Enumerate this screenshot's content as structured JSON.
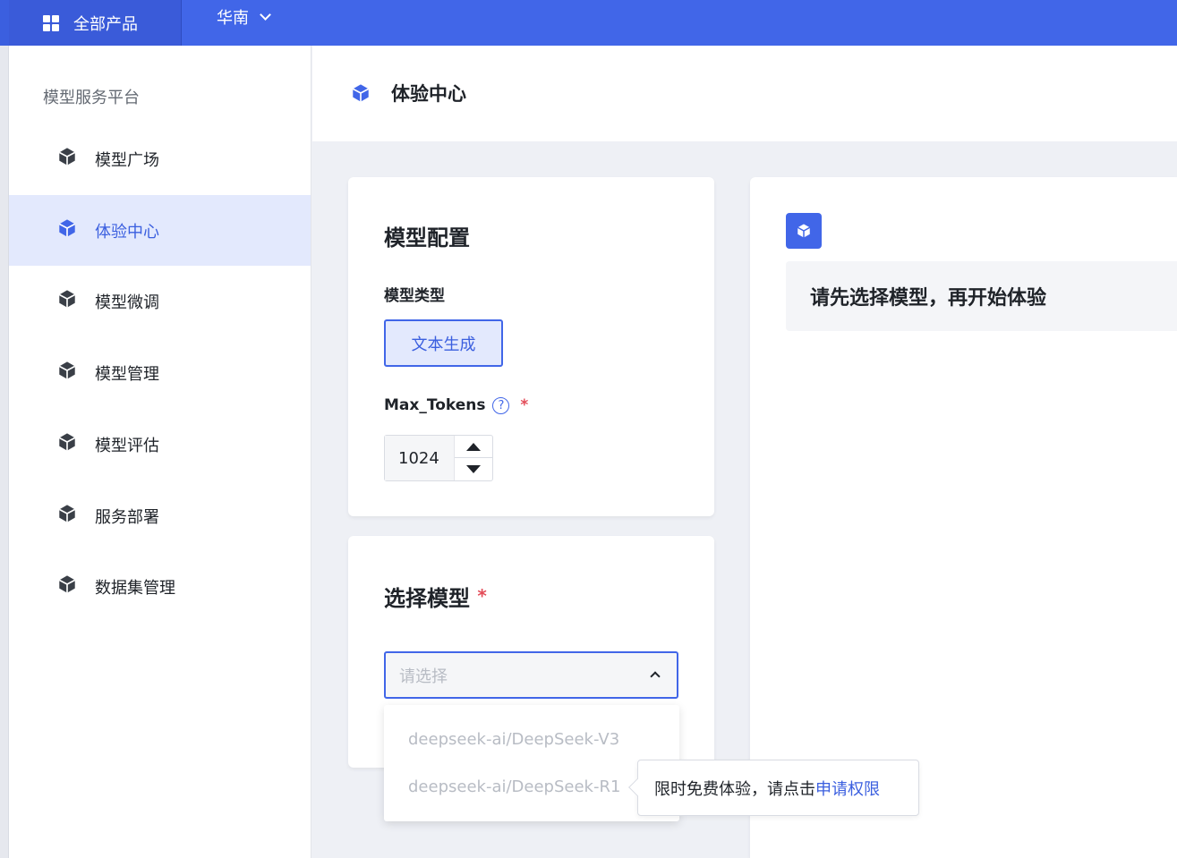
{
  "topbar": {
    "products_label": "全部产品",
    "region_label": "华南"
  },
  "sidebar": {
    "platform_title": "模型服务平台",
    "items": [
      {
        "label": "模型广场",
        "active": false
      },
      {
        "label": "体验中心",
        "active": true
      },
      {
        "label": "模型微调",
        "active": false
      },
      {
        "label": "模型管理",
        "active": false
      },
      {
        "label": "模型评估",
        "active": false
      },
      {
        "label": "服务部署",
        "active": false
      },
      {
        "label": "数据集管理",
        "active": false
      }
    ]
  },
  "header": {
    "title": "体验中心"
  },
  "config": {
    "title": "模型配置",
    "model_type_label": "模型类型",
    "model_type_value": "文本生成",
    "max_tokens_label": "Max_Tokens",
    "help_glyph": "?",
    "required_mark": "*",
    "max_tokens_value": "1024"
  },
  "select_model": {
    "title": "选择模型",
    "required_mark": "*",
    "placeholder": "请选择",
    "options": [
      "deepseek-ai/DeepSeek-V3",
      "deepseek-ai/DeepSeek-R1"
    ]
  },
  "tooltip": {
    "text": "限时免费体验，请点击",
    "link": "申请权限"
  },
  "right_panel": {
    "notice": "请先选择模型，再开始体验"
  },
  "colors": {
    "primary": "#4166e8",
    "active_bg": "#e3e9fd",
    "required": "#e34d59"
  }
}
